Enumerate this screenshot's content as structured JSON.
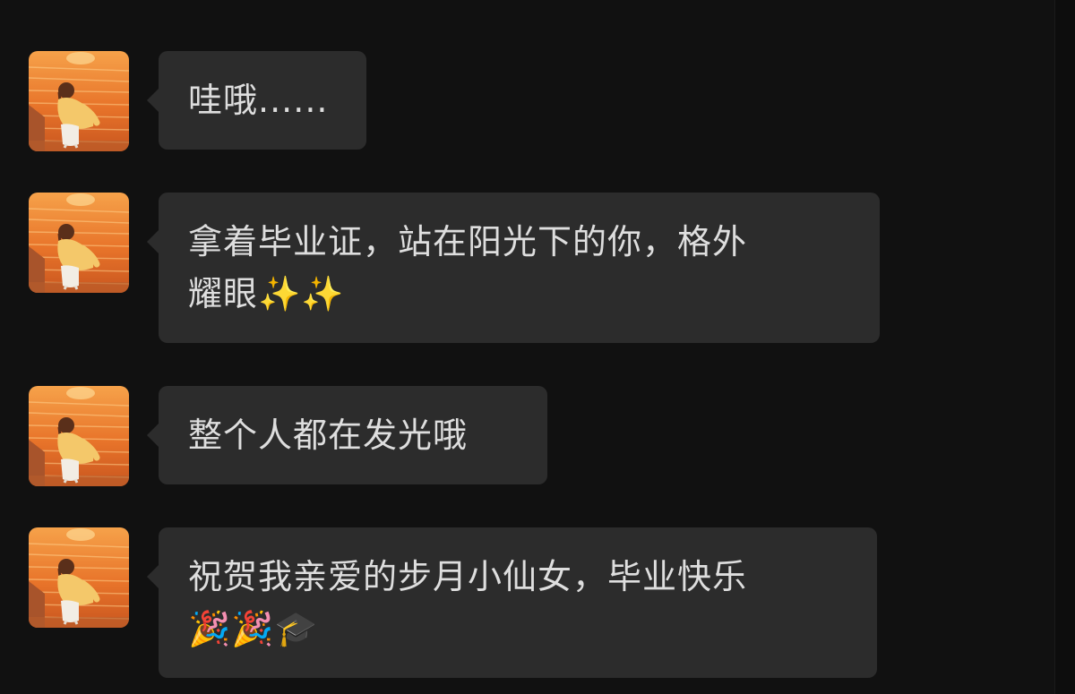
{
  "colors": {
    "background": "#111111",
    "bubble": "#2c2c2c",
    "text": "#dedede"
  },
  "messages": [
    {
      "lines": [
        "哇哦......"
      ]
    },
    {
      "lines": [
        "拿着毕业证，站在阳光下的你，格外",
        "耀眼✨✨"
      ]
    },
    {
      "lines": [
        "整个人都在发光哦"
      ]
    },
    {
      "lines": [
        "祝贺我亲爱的步月小仙女，毕业快乐",
        "🎉🎉🎓"
      ]
    }
  ],
  "avatar": {
    "icon": "sunset-girl-avatar-icon"
  }
}
